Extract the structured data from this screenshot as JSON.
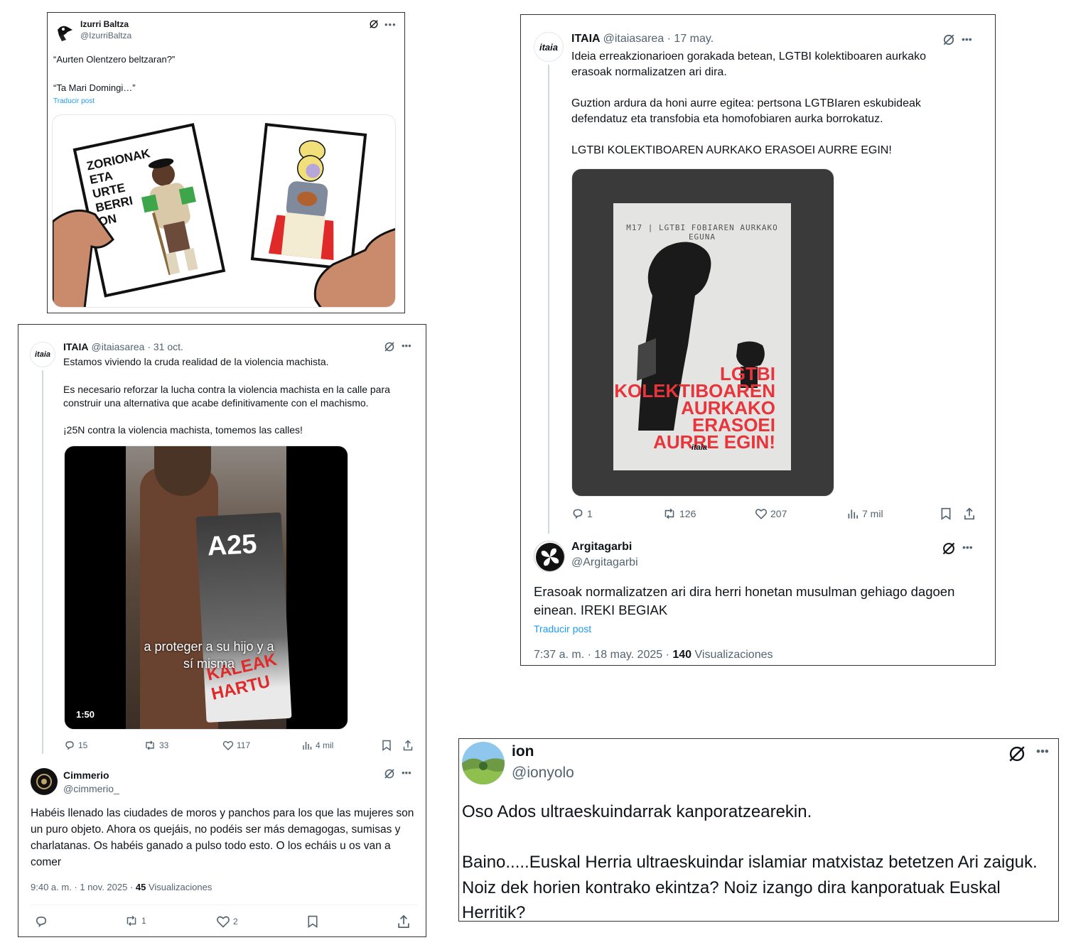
{
  "tweet1": {
    "name": "Izurri Baltza",
    "handle": "@IzurriBaltza",
    "text": "“Aurten Olentzero beltzaran?”\n\n“Ta Mari Domingi…”",
    "translate": "Traducir post",
    "card_left_text": "ZORIONAK ETA URTE BERRI ON"
  },
  "tweet2": {
    "name": "ITAIA",
    "handle_date": "@itaiasarea · 31 oct.",
    "text": "Estamos viviendo la cruda realidad de la violencia machista.\n\nEs necesario reforzar la lucha contra la violencia machista en la calle para construir una alternativa que acabe definitivamente con el machismo.\n\n¡25N contra la violencia machista, tomemos las calles!",
    "video_sign": "A25",
    "video_caption": "a proteger a su hijo y a sí misma",
    "video_poster_text": "KALEAK HARTU",
    "duration": "1:50",
    "replies": "15",
    "reposts": "33",
    "likes": "117",
    "views": "4 mil",
    "avatar_label": "itaia"
  },
  "tweet2_reply": {
    "name": "Cimmerio",
    "handle": "@cimmerio_",
    "text": "Habéis llenado las ciudades de moros y panchos para los que las mujeres son un puro objeto. Ahora os quejáis, no podéis ser más demagogas, sumisas y charlatanas. Os habéis ganado a pulso todo esto. O los echáis u os van a comer",
    "time": "9:40 a. m. · 1 nov. 2025 · ",
    "views_count": "45",
    "views_label": " Visualizaciones",
    "reposts": "1",
    "likes": "2"
  },
  "tweet3": {
    "name": "ITAIA",
    "handle_date": "@itaiasarea · 17 may.",
    "text": "Ideia erreakzionarioen gorakada betean, LGTBI kolektiboaren aurkako erasoak normalizatzen ari dira.\n\nGuztion ardura da honi aurre egitea: pertsona LGTBIaren eskubideak defendatuz eta transfobia eta homofobiaren aurka borrokatuz.\n\nLGTBI KOLEKTIBOAREN AURKAKO ERASOEI AURRE EGIN!",
    "poster_top": "M17 | LGTBI FOBIAREN AURKAKO EGUNA",
    "poster_lines": [
      "LGTBI",
      "KOLEKTIBOAREN",
      "AURKAKO ERASOEI",
      "AURRE EGIN!"
    ],
    "poster_logo": "itaia",
    "avatar_label": "itaia",
    "replies": "1",
    "reposts": "126",
    "likes": "207",
    "views": "7 mil"
  },
  "tweet3_reply": {
    "name": "Argitagarbi",
    "handle": "@Argitagarbi",
    "text": "Erasoak normalizatzen ari dira herri honetan musulman gehiago dagoen einean. IREKI BEGIAK",
    "translate": "Traducir post",
    "time": "7:37 a. m. · 18 may. 2025 · ",
    "views_count": "140",
    "views_label": " Visualizaciones"
  },
  "tweet4": {
    "name": "ion",
    "handle": "@ionyolo",
    "text": "Oso Ados ultraeskuindarrak kanporatzearekin.\n\nBaino.....Euskal Herria ultraeskuindar islamiar matxistaz betetzen Ari zaiguk. Noiz dek horien kontrako ekintza? Noiz izango dira kanporatuak Euskal Herritik?"
  },
  "colors": {
    "link": "#1d9bf0",
    "muted": "#536471",
    "poster_red": "#e8343a",
    "border": "#333333"
  },
  "icons": [
    "grok-icon",
    "more-icon",
    "reply-icon",
    "repost-icon",
    "like-icon",
    "views-icon",
    "bookmark-icon",
    "share-icon"
  ]
}
